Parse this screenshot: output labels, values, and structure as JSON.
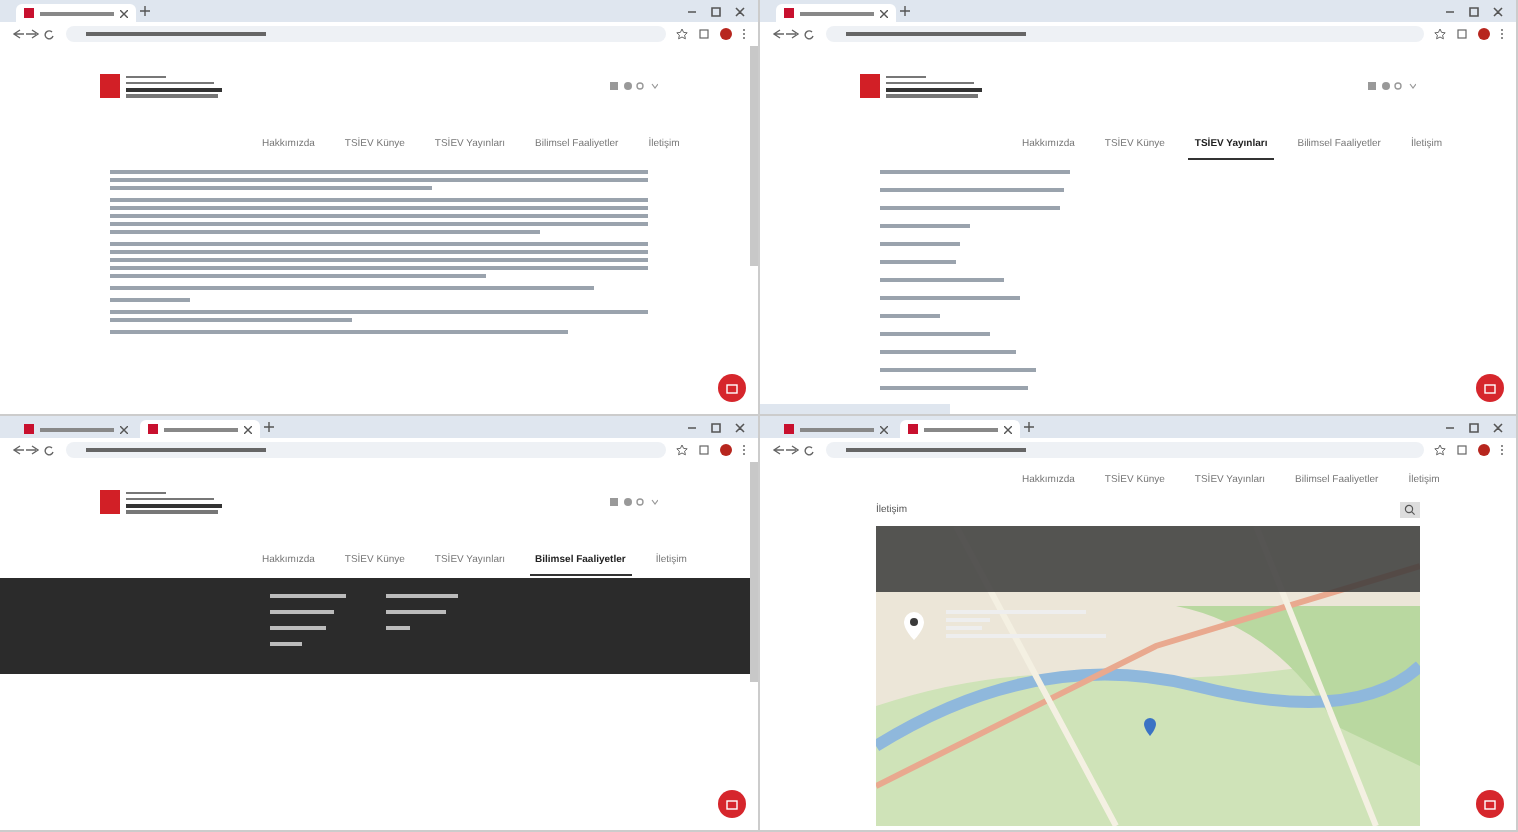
{
  "windows": [
    {
      "tabs": [
        {
          "selected": true
        }
      ],
      "page": {
        "kind": "article",
        "nav": [
          {
            "label": "Hakkımızda",
            "selected": false
          },
          {
            "label": "TSİEV Künye",
            "selected": false
          },
          {
            "label": "TSİEV Yayınları",
            "selected": false
          },
          {
            "label": "Bilimsel Faaliyetler",
            "selected": false
          },
          {
            "label": "İletişim",
            "selected": false
          }
        ]
      }
    },
    {
      "tabs": [
        {
          "selected": true
        }
      ],
      "page": {
        "kind": "list",
        "nav": [
          {
            "label": "Hakkımızda",
            "selected": false
          },
          {
            "label": "TSİEV Künye",
            "selected": false
          },
          {
            "label": "TSİEV Yayınları",
            "selected": true
          },
          {
            "label": "Bilimsel Faaliyetler",
            "selected": false
          },
          {
            "label": "İletişim",
            "selected": false
          }
        ]
      }
    },
    {
      "tabs": [
        {
          "selected": false
        },
        {
          "selected": true
        }
      ],
      "page": {
        "kind": "menu",
        "nav": [
          {
            "label": "Hakkımızda",
            "selected": false
          },
          {
            "label": "TSİEV Künye",
            "selected": false
          },
          {
            "label": "TSİEV Yayınları",
            "selected": false
          },
          {
            "label": "Bilimsel Faaliyetler",
            "selected": true
          },
          {
            "label": "İletişim",
            "selected": false
          }
        ]
      }
    },
    {
      "tabs": [
        {
          "selected": false
        },
        {
          "selected": true
        }
      ],
      "page": {
        "kind": "map",
        "title": "İletişim",
        "nav": [
          {
            "label": "Hakkımızda",
            "selected": false
          },
          {
            "label": "TSİEV Künye",
            "selected": false
          },
          {
            "label": "TSİEV Yayınları",
            "selected": false
          },
          {
            "label": "Bilimsel Faaliyetler",
            "selected": false
          },
          {
            "label": "İletişim",
            "selected": false
          }
        ]
      }
    }
  ]
}
